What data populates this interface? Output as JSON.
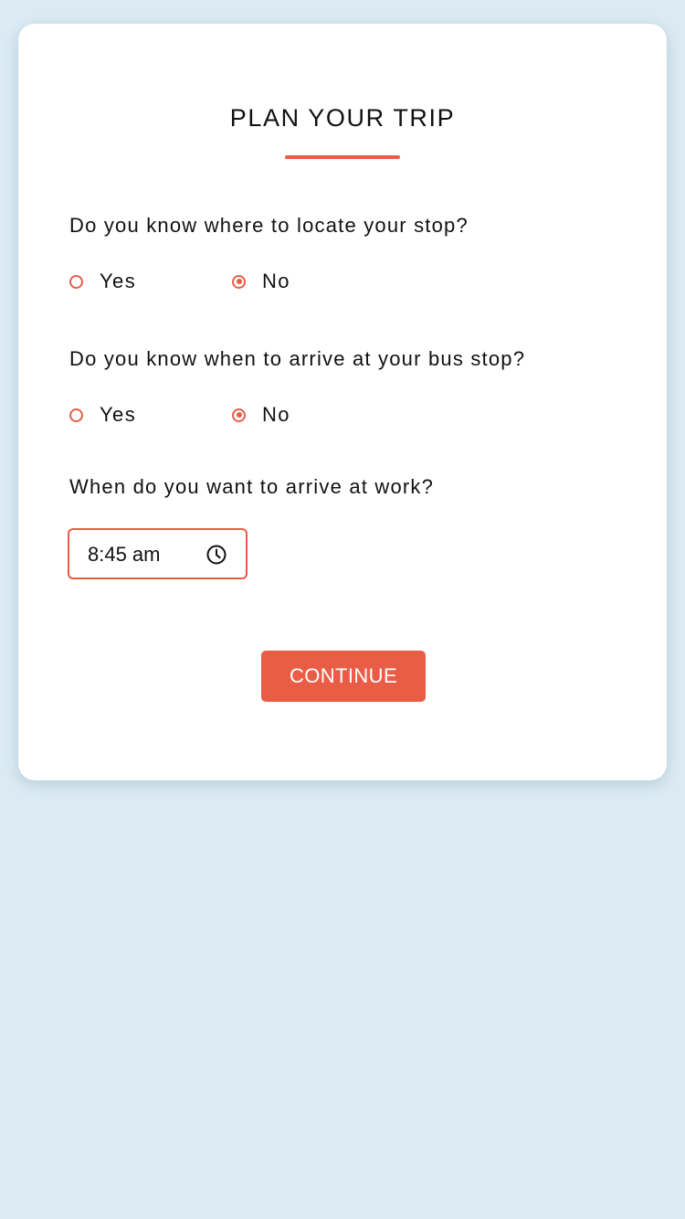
{
  "form": {
    "title": "PLAN YOUR TRIP",
    "accent_color": "#e95d47",
    "background_color": "#dbeaf3",
    "questions": [
      {
        "text": "Do you know where to locate your stop?",
        "options": [
          {
            "label": "Yes",
            "selected": false
          },
          {
            "label": "No",
            "selected": true
          }
        ]
      },
      {
        "text": "Do you know when to arrive at your bus stop?",
        "options": [
          {
            "label": "Yes",
            "selected": false
          },
          {
            "label": "No",
            "selected": true
          }
        ]
      }
    ],
    "arrival": {
      "question": "When do you want to arrive at work?",
      "time_value": "8:45 am",
      "icon": "clock-icon"
    },
    "continue_label": "CONTINUE"
  }
}
